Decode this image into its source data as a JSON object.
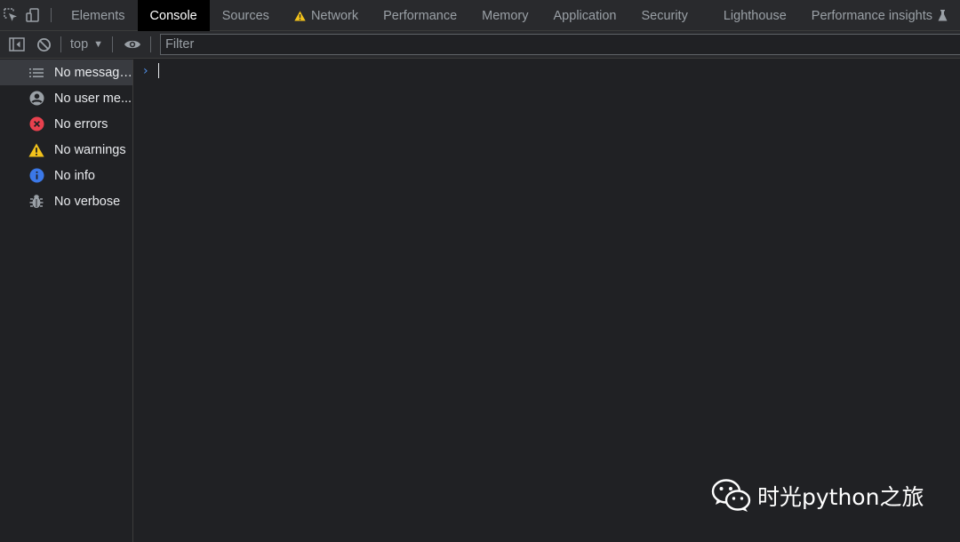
{
  "tabbar": {
    "icons": [
      "inspect-element-icon",
      "device-toolbar-icon"
    ],
    "tabs": [
      {
        "label": "Elements"
      },
      {
        "label": "Console",
        "active": true
      },
      {
        "label": "Sources"
      },
      {
        "label": "Network",
        "icon": "warning-icon"
      },
      {
        "label": "Performance"
      },
      {
        "label": "Memory"
      },
      {
        "label": "Application"
      },
      {
        "label": "Security"
      },
      {
        "label": "Lighthouse"
      },
      {
        "label": "Performance insights",
        "icon": "flask-icon"
      }
    ]
  },
  "toolbar": {
    "icons": [
      "sidebar-toggle-icon",
      "clear-console-icon",
      "eye-icon"
    ],
    "context": "top",
    "filter_placeholder": "Filter",
    "filter_value": ""
  },
  "sidebar": {
    "items": [
      {
        "label": "No messages",
        "icon": "list-icon",
        "selected": true
      },
      {
        "label": "No user me...",
        "icon": "user-icon"
      },
      {
        "label": "No errors",
        "icon": "error-icon",
        "color": "#e8414e"
      },
      {
        "label": "No warnings",
        "icon": "warning-icon",
        "color": "#f2c21b"
      },
      {
        "label": "No info",
        "icon": "info-icon",
        "color": "#3b78e7"
      },
      {
        "label": "No verbose",
        "icon": "bug-icon"
      }
    ]
  },
  "console": {
    "prompt": ">"
  },
  "watermark": {
    "text": "时光python之旅",
    "logo": "wechat-logo"
  },
  "colors": {
    "background": "#202124",
    "toolbar": "#292a2d",
    "active_tab": "#000000",
    "accent": "#4e8de4"
  }
}
